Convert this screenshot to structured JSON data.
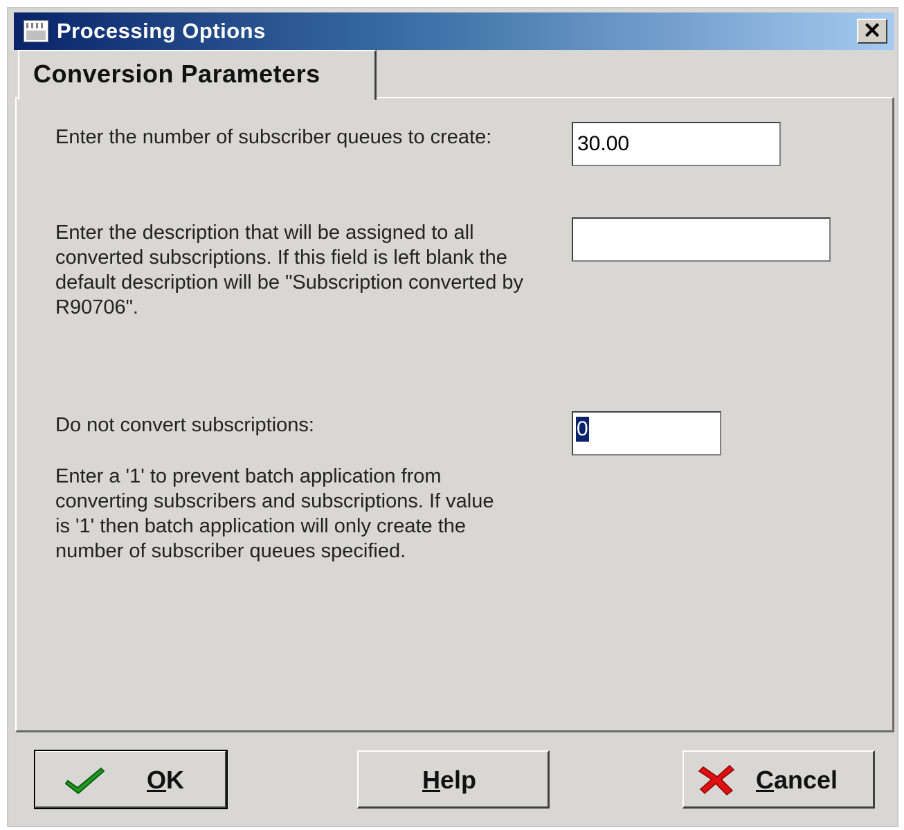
{
  "window": {
    "title": "Processing Options",
    "close_glyph": "✕"
  },
  "tabs": [
    {
      "label": "Conversion Parameters",
      "active": true
    }
  ],
  "fields": {
    "queues": {
      "label": "Enter the number of subscriber queues to create:",
      "value": "30.00"
    },
    "description": {
      "label": "Enter the description that will be assigned to all converted subscriptions. If this field is left blank the default description will be \"Subscription converted by R90706\".",
      "value": ""
    },
    "do_not_convert": {
      "label": "Do not convert subscriptions:",
      "value": "0",
      "help": "Enter a '1' to prevent batch application from converting subscribers and subscriptions. If value is '1' then batch application will only create the number of subscriber queues specified."
    }
  },
  "buttons": {
    "ok": {
      "label": "OK",
      "mnemonic": "O",
      "rest": "K",
      "icon": "checkmark-icon"
    },
    "help": {
      "label": "Help",
      "mnemonic": "H",
      "rest": "elp"
    },
    "cancel": {
      "label": "Cancel",
      "mnemonic": "C",
      "rest": "ancel",
      "icon": "red-x-icon"
    }
  },
  "colors": {
    "title_start": "#0a246a",
    "title_end": "#a6caf0",
    "face": "#d8d7d3",
    "check_green": "#1e9a1e",
    "cancel_red": "#e01010"
  }
}
